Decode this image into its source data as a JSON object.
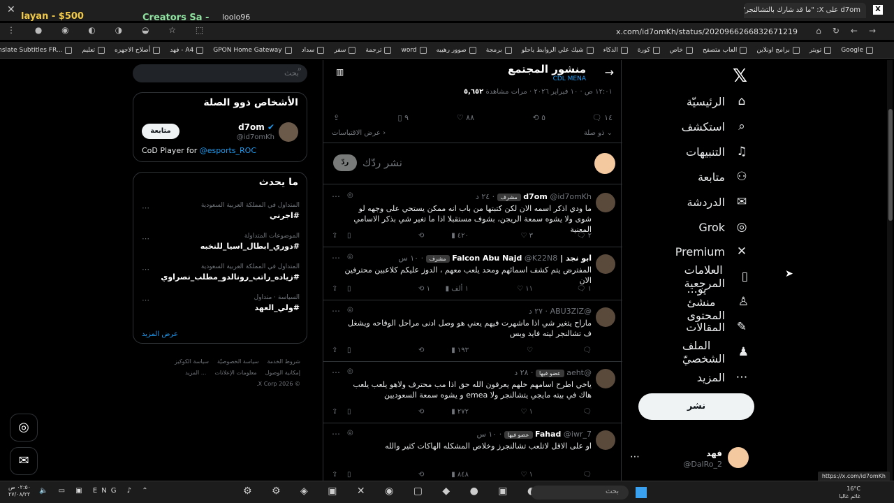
{
  "browser": {
    "tab_title": "d7om على X: \"ما قد شارك بالتشالنجر\"",
    "url": "x.com/id7omKh/status/2020966266832671219",
    "overlay_left": "layan - $500",
    "overlay_mid": "Creators Sa -",
    "overlay_user": "loolo96",
    "bookmarks": [
      "Google",
      "تويتر",
      "برامج اونلاين",
      "العاب متصفح",
      "خاص",
      "كورة",
      "الذكاء",
      "شيك علي الروابط ياحلو",
      "برمجة",
      "صوور رهيبه",
      "word",
      "ترجمة",
      "سفر",
      "سداد",
      "GPON Home Gateway",
      "فهد - A4",
      "أصلاح الاجهزه",
      "تعليم",
      "Translate Subtitles FR..."
    ]
  },
  "nav": {
    "items": [
      {
        "label": "الرئيسيّة",
        "icon": "home-icon",
        "glyph": "⌂"
      },
      {
        "label": "استكشف",
        "icon": "search-icon",
        "glyph": "⌕"
      },
      {
        "label": "التنبيهات",
        "icon": "bell-icon",
        "glyph": "♫"
      },
      {
        "label": "متابعة",
        "icon": "follow-icon",
        "glyph": "⚇"
      },
      {
        "label": "الدردشة",
        "icon": "mail-icon",
        "glyph": "✉"
      },
      {
        "label": "Grok",
        "icon": "grok-icon",
        "glyph": "◎"
      },
      {
        "label": "Premium",
        "icon": "x-logo-icon",
        "glyph": "✕"
      },
      {
        "label": "العلامات المرجعية",
        "icon": "bookmark-icon",
        "glyph": "▯"
      },
      {
        "label": "...يو منشئ المحتوى",
        "icon": "creator-icon",
        "glyph": "♙"
      },
      {
        "label": "المقالات",
        "icon": "article-icon",
        "glyph": "✎"
      },
      {
        "label": "الملف الشخصيّ",
        "icon": "profile-icon",
        "glyph": "♟"
      },
      {
        "label": "المزيد",
        "icon": "more-icon",
        "glyph": "⋯"
      }
    ],
    "post_label": "نشر",
    "account": {
      "name": "فهد",
      "handle": "@DalRo_2"
    }
  },
  "main": {
    "title": "منشور المجتمع",
    "subtitle": "CDL MENA",
    "meta": "١٢:٠١ ص · ١٠ فبراير ٢٠٢٦ · مرات مشاهدة",
    "views": "٥,٦٥٢",
    "stats": {
      "replies": "١٤",
      "reposts": "٥",
      "likes": "٨٨",
      "bookmarks": "٩"
    },
    "sort_label": "ذو صلة",
    "show_activity": "عرض الاقتباسات",
    "reply_placeholder": "نشر ردّك",
    "reply_button": "ردّ",
    "tweets": [
      {
        "name": "d7om",
        "handle": "@id7omKh",
        "badge": "مشرف",
        "time": "٢٤ د",
        "text": "ما ودي اذكر اسمه الان لكن كتبتها من باب انه ممكن يستحي على وجهه لو شوى ولا يشوه سمعة الريجن، بشوف مستقبلا اذا ما تغير شي بذكر الاسامي المعنية",
        "replies": "٢",
        "reposts": "",
        "likes": "٣",
        "views": "٤٢٠"
      },
      {
        "name": "ابو نجد | Falcon Abu Najd",
        "handle": "@K22N8",
        "badge": "مشرف",
        "time": "١٠ س",
        "text": "المفترض يتم كشف اسمائهم ومحد يلعب معهم ، الدوز عليكم كلاعبين محترفين الان",
        "replies": "١",
        "reposts": "١",
        "likes": "١١",
        "views": "١ ألف"
      },
      {
        "name": "",
        "handle": "@ABU3ZIZ",
        "badge": "",
        "time": "٢٧ د",
        "text": "ماراح يتغير شي اذا ماشهرت فيهم يعني هو وصل ادنى مراحل الوقاحه ويشغل ف تشالنجر ليته فايد وبس",
        "replies": "",
        "reposts": "",
        "likes": "",
        "views": "١٩٣"
      },
      {
        "name": "",
        "handle": "@aeht",
        "badge": "عضو فيها",
        "time": "٢٨ د",
        "text": "ياخي اطرح اسامهم خلهم يعرفون الله حق اذا مب محترف ولاهو يلعب يلعب هاك في بيته مايجي يتشالنجر ولا emea و يشوه سمعة السعوديين",
        "replies": "",
        "reposts": "",
        "likes": "١",
        "views": "٢٧٢"
      },
      {
        "name": "Fahad",
        "handle": "@iwr_7",
        "badge": "عضو فيها",
        "time": "١٠ س",
        "text": "او على الاقل لاتلعب تشالنجرز وخلاص المشكله الهاكات كثير والله",
        "replies": "",
        "reposts": "",
        "likes": "١",
        "views": "٨٤٨"
      }
    ]
  },
  "sidebar": {
    "search_placeholder": "بحث",
    "people_title": "الأشخاص ذوو الصلة",
    "person": {
      "name": "d7om",
      "handle": "@id7omKh",
      "follow": "متابعة",
      "bio": "CoD Player for",
      "bio_link": "@esports_ROC"
    },
    "trends_title": "ما يحدث",
    "trends": [
      {
        "category": "المتداول في المملكة العربية السعودية",
        "name": "#اجرني"
      },
      {
        "category": "الموضوعات المتداولة",
        "name": "#دوري_ابطال_اسيا_للنخبه"
      },
      {
        "category": "المتداول في المملكة العربية السعودية",
        "name": "#زياده_راتب_رونالدو_مطلب_نصراوي"
      },
      {
        "category": "السياسة · متداول",
        "name": "#ولي_العهد"
      }
    ],
    "show_more": "عرض المزيد",
    "footer": [
      "شروط الخدمة",
      "سياسة الخصوصيّة",
      "سياسة الكوكيز",
      "إمكانية الوصول",
      "معلومات الإعلانات",
      "... المزيد",
      "© 2026 X Corp."
    ]
  },
  "statusbar_url": "https://x.com/id7omKh",
  "taskbar": {
    "search": "بحث",
    "time": "٠٢:٥٠ ص",
    "date": "٢٧/٠٨/٢٢",
    "lang": "ENG",
    "temp": "16°C",
    "weather": "غائم غالبا"
  }
}
